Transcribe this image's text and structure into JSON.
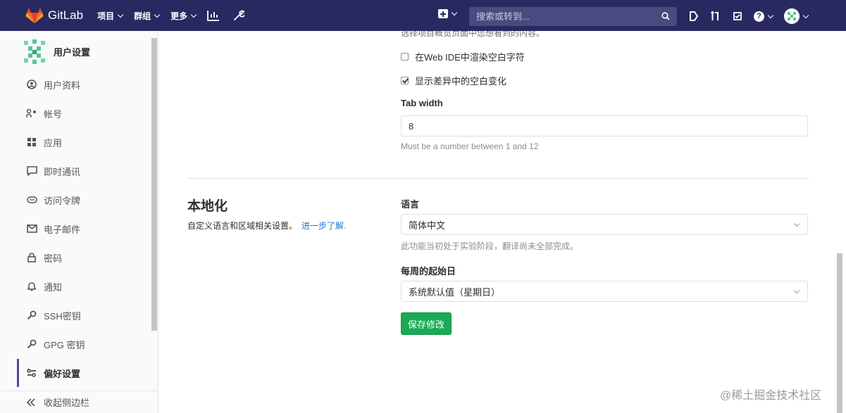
{
  "navbar": {
    "brand": "GitLab",
    "menus": [
      {
        "label": "项目"
      },
      {
        "label": "群组"
      },
      {
        "label": "更多"
      }
    ],
    "search_placeholder": "搜索或转到...",
    "icons": [
      "plus-square-icon",
      "chart-icon",
      "wrench-icon",
      "todo-icon",
      "merge-request-icon",
      "issues-icon",
      "help-icon",
      "user-avatar"
    ]
  },
  "sidebar": {
    "title": "用户设置",
    "items": [
      {
        "label": "用户资料",
        "icon": "profile-icon"
      },
      {
        "label": "帐号",
        "icon": "account-icon"
      },
      {
        "label": "应用",
        "icon": "applications-icon"
      },
      {
        "label": "即时通讯",
        "icon": "chat-icon"
      },
      {
        "label": "访问令牌",
        "icon": "token-icon"
      },
      {
        "label": "电子邮件",
        "icon": "mail-icon"
      },
      {
        "label": "密码",
        "icon": "lock-icon"
      },
      {
        "label": "通知",
        "icon": "bell-icon"
      },
      {
        "label": "SSH密钥",
        "icon": "key-icon"
      },
      {
        "label": "GPG 密钥",
        "icon": "key-icon"
      },
      {
        "label": "偏好设置",
        "icon": "preferences-icon",
        "active": true
      }
    ],
    "collapse": "收起侧边栏"
  },
  "main": {
    "cutoff_text": "选择项目概览页面中您想看到的内容。",
    "whitespace_ide": {
      "label": "在Web IDE中渲染空白字符",
      "checked": false
    },
    "whitespace_diff": {
      "label": "显示差异中的空白变化",
      "checked": true
    },
    "tab_width": {
      "label": "Tab width",
      "value": "8",
      "help": "Must be a number between 1 and 12"
    },
    "localization": {
      "title": "本地化",
      "desc": "自定义语言和区域相关设置。",
      "link": "进一步了解.",
      "language": {
        "label": "语言",
        "value": "简体中文",
        "help": "此功能当初处于实验阶段，翻译尚未全部完成。"
      },
      "first_day": {
        "label": "每周的起始日",
        "value": "系统默认值（星期日）"
      }
    },
    "save_label": "保存修改"
  },
  "watermark": "@稀土掘金技术社区"
}
